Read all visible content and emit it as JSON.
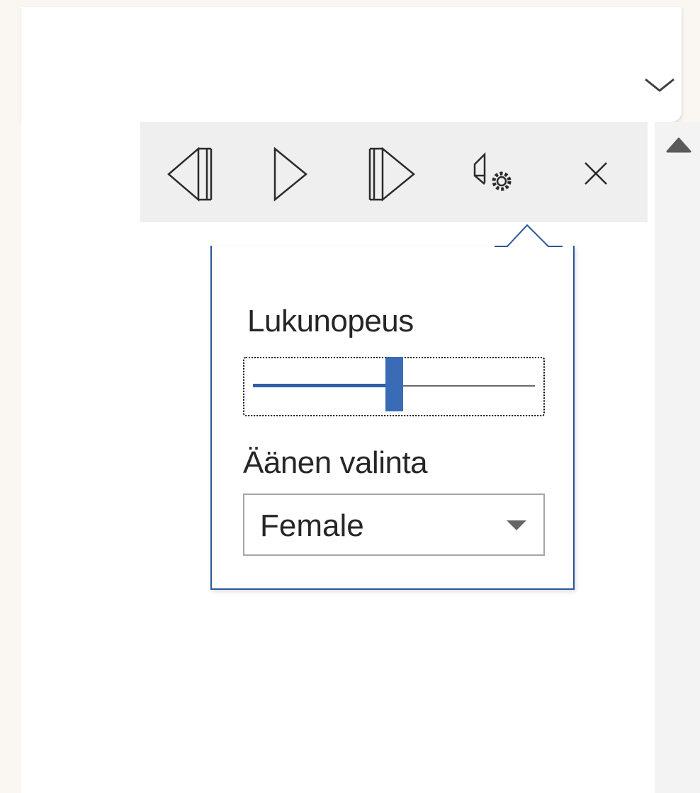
{
  "toolbar": {
    "buttons": [
      {
        "name": "previous",
        "icon": "previous-paragraph-icon"
      },
      {
        "name": "play",
        "icon": "play-icon"
      },
      {
        "name": "next",
        "icon": "next-paragraph-icon"
      },
      {
        "name": "settings",
        "icon": "voice-settings-icon"
      },
      {
        "name": "close",
        "icon": "close-icon"
      }
    ]
  },
  "popup": {
    "speed_label": "Lukunopeus",
    "speed_value": 0.5,
    "voice_label": "Äänen valinta",
    "voice_value": "Female"
  },
  "colors": {
    "accent": "#2b579a",
    "slider": "#3a6bb6",
    "toolbar_bg": "#efefef"
  }
}
